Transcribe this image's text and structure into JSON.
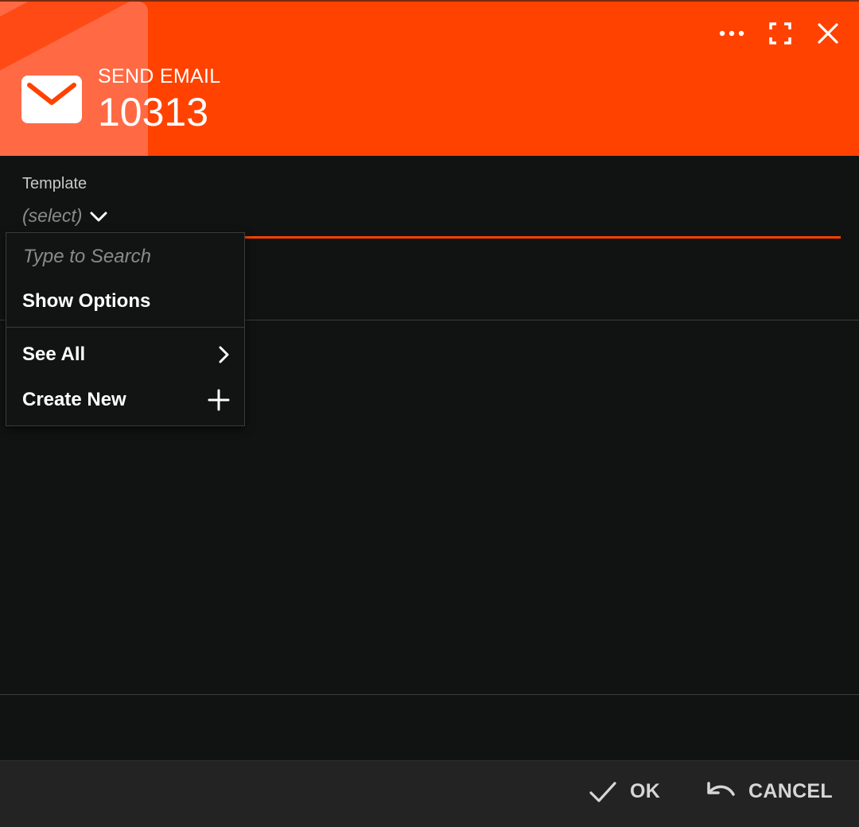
{
  "header": {
    "subtitle": "SEND EMAIL",
    "title": "10313",
    "icons": [
      "mail-icon",
      "more-icon",
      "fullscreen-icon",
      "close-icon"
    ],
    "accent_color": "#ff4200"
  },
  "form": {
    "template_label": "Template",
    "template_value": "(select)"
  },
  "dropdown": {
    "search_placeholder": "Type to Search",
    "show_options": "Show Options",
    "see_all": "See All",
    "create_new": "Create New"
  },
  "footer": {
    "ok_label": "OK",
    "cancel_label": "CANCEL"
  }
}
